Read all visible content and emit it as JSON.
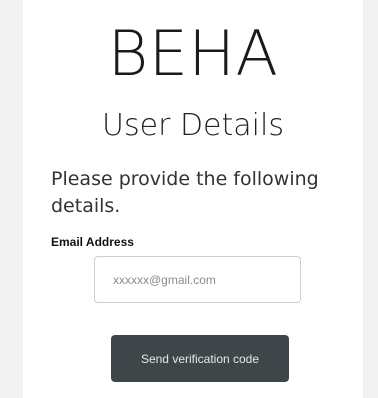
{
  "brand": {
    "logo_text": "BEHA"
  },
  "page": {
    "title": "User Details",
    "instructions": "Please provide the following details."
  },
  "form": {
    "email": {
      "label": "Email Address",
      "placeholder": "xxxxxx@gmail.com",
      "value": ""
    },
    "submit_label": "Send verification code"
  },
  "colors": {
    "background": "#f2f2f2",
    "card": "#ffffff",
    "button": "#3e4649",
    "button_text": "#e8e8e8",
    "input_border": "#cfcfcf"
  }
}
